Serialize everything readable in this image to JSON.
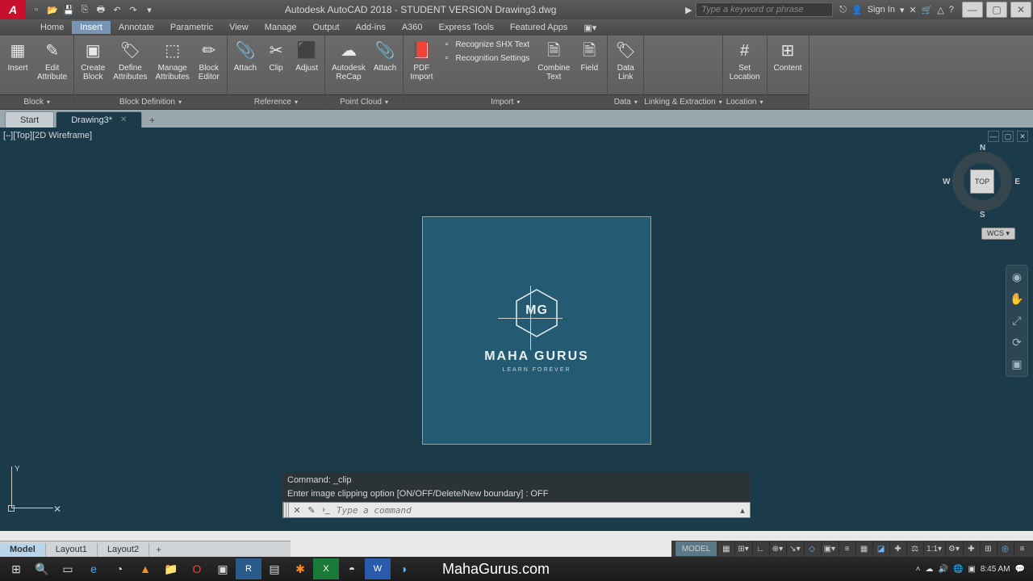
{
  "titlebar": {
    "app_title": "Autodesk AutoCAD 2018 - STUDENT VERSION   Drawing3.dwg",
    "search_placeholder": "Type a keyword or phrase",
    "signin": "Sign In"
  },
  "menus": [
    "Home",
    "Insert",
    "Annotate",
    "Parametric",
    "View",
    "Manage",
    "Output",
    "Add-ins",
    "A360",
    "Express Tools",
    "Featured Apps"
  ],
  "active_menu": 1,
  "ribbon": {
    "panels": [
      {
        "label": "Block",
        "items": [
          {
            "t": "Insert"
          },
          {
            "t": "Edit\nAttribute"
          }
        ]
      },
      {
        "label": "Block Definition",
        "items": [
          {
            "t": "Create\nBlock"
          },
          {
            "t": "Define\nAttributes"
          },
          {
            "t": "Manage\nAttributes"
          },
          {
            "t": "Block\nEditor"
          }
        ]
      },
      {
        "label": "Reference",
        "items": [
          {
            "t": "Attach"
          },
          {
            "t": "Clip"
          },
          {
            "t": "Adjust"
          }
        ]
      },
      {
        "label": "Point Cloud",
        "items": [
          {
            "t": "Autodesk\nReCap"
          },
          {
            "t": "Attach"
          }
        ]
      },
      {
        "label": "Import",
        "items": [
          {
            "t": "PDF\nImport"
          }
        ],
        "extras": [
          {
            "t": "Recognize SHX Text"
          },
          {
            "t": "Recognition Settings"
          }
        ],
        "extras2": [
          {
            "t": "Combine\nText"
          },
          {
            "t": "Field"
          }
        ]
      },
      {
        "label": "Data",
        "items": [
          {
            "t": "Data\nLink"
          }
        ]
      },
      {
        "label": "Linking & Extraction",
        "items": []
      },
      {
        "label": "Location",
        "items": [
          {
            "t": "Set\nLocation"
          }
        ]
      },
      {
        "label": "",
        "items": [
          {
            "t": "Content"
          }
        ]
      }
    ]
  },
  "filetabs": [
    {
      "label": "Start",
      "active": false
    },
    {
      "label": "Drawing3*",
      "active": true
    }
  ],
  "viewport_label": "[–][Top][2D Wireframe]",
  "viewcube": {
    "face": "TOP",
    "n": "N",
    "s": "S",
    "e": "E",
    "w": "W",
    "wcs": "WCS ▾"
  },
  "image": {
    "mg": "MG",
    "brand": "MAHA GURUS",
    "tag": "LEARN FOREVER"
  },
  "ucs": {
    "y": "Y"
  },
  "cmd_history": [
    "Command: _clip",
    "Enter image clipping option [ON/OFF/Delete/New boundary] <New>: OFF"
  ],
  "cmd_placeholder": "Type a command",
  "layouts": [
    "Model",
    "Layout1",
    "Layout2"
  ],
  "active_layout": 0,
  "status": {
    "model": "MODEL",
    "scale": "1:1"
  },
  "watermark": "MahaGurus.com",
  "tray": {
    "time": "8:45 AM"
  }
}
